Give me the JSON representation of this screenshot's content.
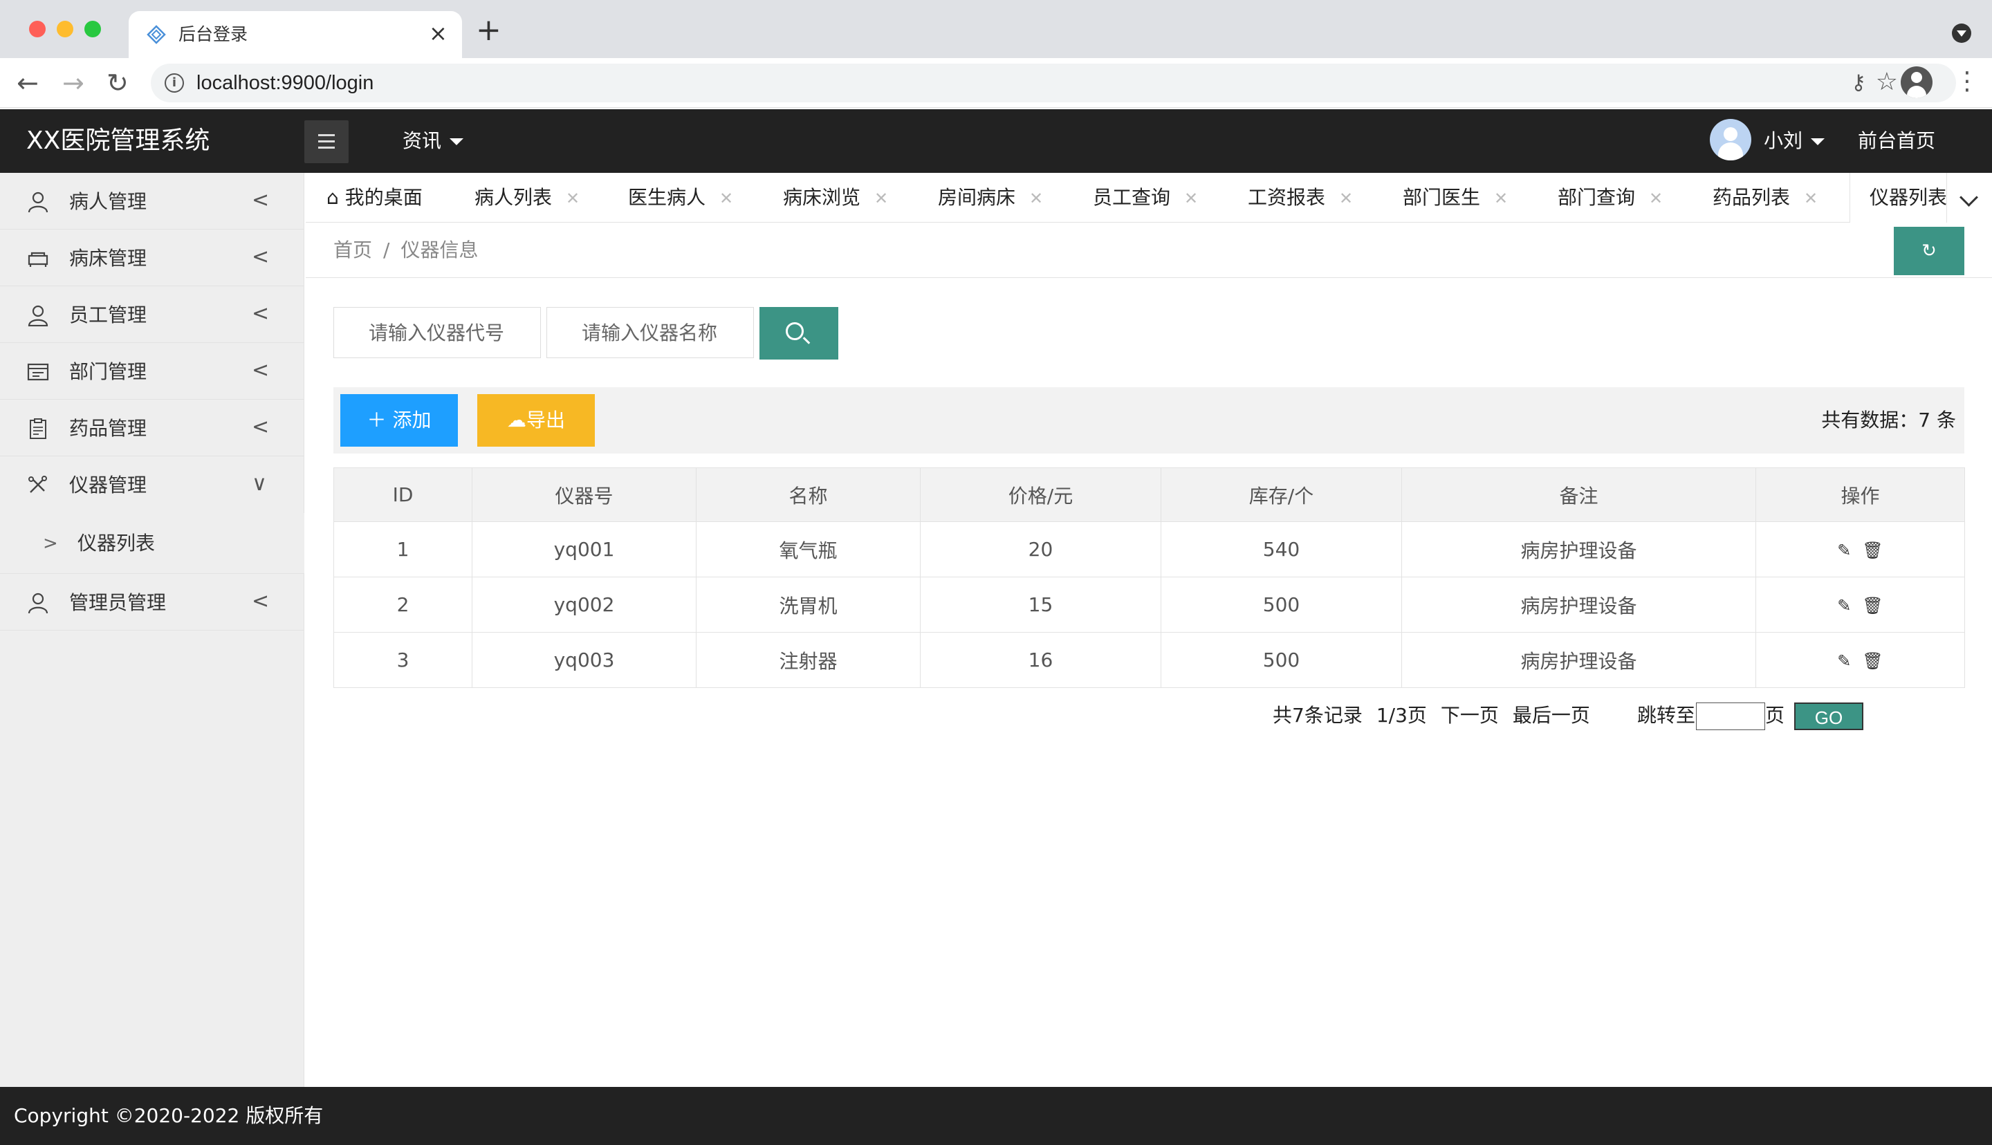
{
  "browser": {
    "tab_title": "后台登录",
    "tab_close": "×",
    "new_tab": "+",
    "url": "localhost:9900/login"
  },
  "header": {
    "logo": "XX医院管理系统",
    "nav_item": "资讯",
    "user_name": "小刘",
    "front_link": "前台首页"
  },
  "sidebar": {
    "items": [
      {
        "label": "病人管理",
        "icon": "user-icon",
        "arrow": "<"
      },
      {
        "label": "病床管理",
        "icon": "bed-icon",
        "arrow": "<"
      },
      {
        "label": "员工管理",
        "icon": "staff-icon",
        "arrow": "<"
      },
      {
        "label": "部门管理",
        "icon": "department-icon",
        "arrow": "<"
      },
      {
        "label": "药品管理",
        "icon": "clipboard-icon",
        "arrow": "<"
      },
      {
        "label": "仪器管理",
        "icon": "tools-icon",
        "arrow": "∨"
      },
      {
        "label": "管理员管理",
        "icon": "admin-icon",
        "arrow": "<"
      }
    ],
    "sub_item": {
      "label": "仪器列表",
      "arrow": ">"
    }
  },
  "tabs": [
    {
      "label": "我的桌面"
    },
    {
      "label": "病人列表"
    },
    {
      "label": "医生病人"
    },
    {
      "label": "病床浏览"
    },
    {
      "label": "房间病床"
    },
    {
      "label": "员工查询"
    },
    {
      "label": "工资报表"
    },
    {
      "label": "部门医生"
    },
    {
      "label": "部门查询"
    },
    {
      "label": "药品列表"
    },
    {
      "label": "仪器列表"
    }
  ],
  "breadcrumb": {
    "home": "首页",
    "separator": "/",
    "current": "仪器信息"
  },
  "search": {
    "code_placeholder": "请输入仪器代号",
    "name_placeholder": "请输入仪器名称"
  },
  "actions": {
    "add_label": "添加",
    "export_label": "导出",
    "total_text": "共有数据：7 条"
  },
  "table": {
    "headers": [
      "ID",
      "仪器号",
      "名称",
      "价格/元",
      "库存/个",
      "备注",
      "操作"
    ],
    "rows": [
      {
        "id": "1",
        "code": "yq001",
        "name": "氧气瓶",
        "price": "20",
        "stock": "540",
        "note": "病房护理设备"
      },
      {
        "id": "2",
        "code": "yq002",
        "name": "洗胃机",
        "price": "15",
        "stock": "500",
        "note": "病房护理设备"
      },
      {
        "id": "3",
        "code": "yq003",
        "name": "注射器",
        "price": "16",
        "stock": "500",
        "note": "病房护理设备"
      }
    ]
  },
  "pagination": {
    "total": "共7条记录",
    "page": "1/3页",
    "next": "下一页",
    "last": "最后一页",
    "jump_label": "跳转至",
    "unit": "页",
    "go": "GO"
  },
  "footer": {
    "copyright": "Copyright ©2020-2022 版权所有"
  },
  "colors": {
    "primary": "#3c9485",
    "add": "#1e9fff",
    "export": "#f7b824",
    "header_bg": "#222222"
  }
}
